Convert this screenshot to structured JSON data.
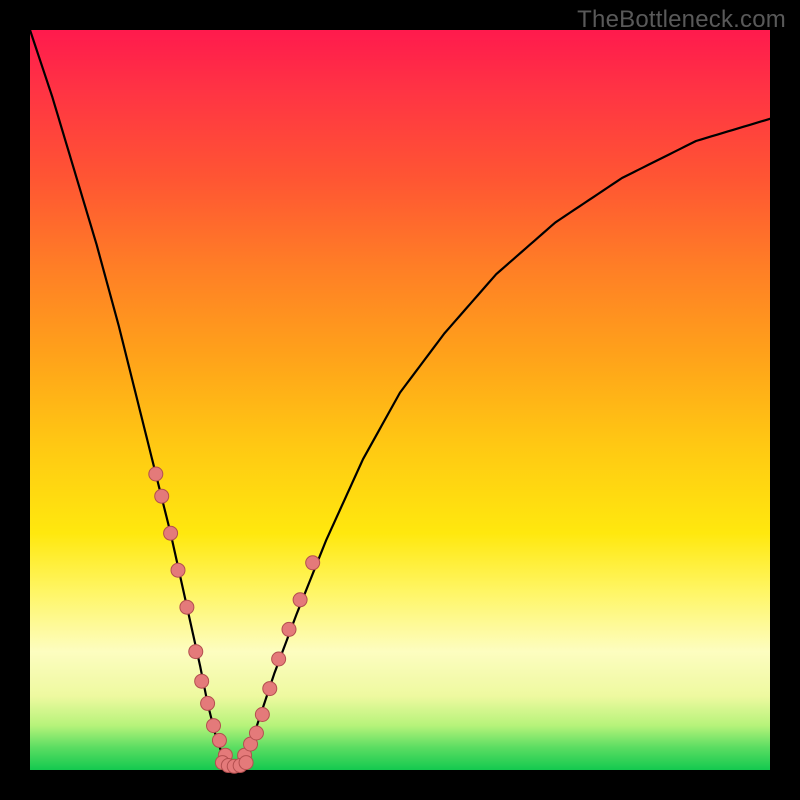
{
  "watermark": "TheBottleneck.com",
  "colors": {
    "background": "#000000",
    "curve_stroke": "#000000",
    "dot_fill": "#e47a7a",
    "dot_stroke": "#b34f4f",
    "gradient_top": "#ff1a4d",
    "gradient_bottom": "#13c94f"
  },
  "chart_data": {
    "type": "line",
    "title": "",
    "xlabel": "",
    "ylabel": "",
    "xlim": [
      0,
      100
    ],
    "ylim": [
      0,
      100
    ],
    "legend": false,
    "grid": false,
    "annotations": [],
    "description": "V-shaped bottleneck curve. Y value represents bottleneck severity (100 = worst/red, 0 = none/green). Minimum (optimal balance point) occurs near x ≈ 27. Left branch descends steeply from top-left; right branch rises with decreasing slope toward top-right.",
    "series": [
      {
        "name": "bottleneck-curve",
        "x": [
          0,
          3,
          6,
          9,
          12,
          15,
          17,
          19,
          21,
          23,
          24,
          25,
          26,
          27,
          28,
          29,
          30,
          31,
          33,
          36,
          40,
          45,
          50,
          56,
          63,
          71,
          80,
          90,
          100
        ],
        "y": [
          100,
          91,
          81,
          71,
          60,
          48,
          40,
          32,
          23,
          14,
          9,
          5,
          2,
          0.5,
          0.5,
          2,
          4,
          7,
          13,
          21,
          31,
          42,
          51,
          59,
          67,
          74,
          80,
          85,
          88
        ]
      }
    ],
    "dots_left_branch": {
      "name": "highlight-dots-left",
      "x": [
        17.0,
        17.8,
        19.0,
        20.0,
        21.2,
        22.4,
        23.2,
        24.0,
        24.8,
        25.6,
        26.4
      ],
      "y": [
        40,
        37,
        32,
        27,
        22,
        16,
        12,
        9,
        6,
        4,
        2
      ]
    },
    "dots_right_branch": {
      "name": "highlight-dots-right",
      "x": [
        29.0,
        29.8,
        30.6,
        31.4,
        32.4,
        33.6,
        35.0,
        36.5,
        38.2
      ],
      "y": [
        2,
        3.5,
        5,
        7.5,
        11,
        15,
        19,
        23,
        28
      ]
    },
    "dots_valley": {
      "name": "highlight-dots-valley",
      "x": [
        26.0,
        26.8,
        27.6,
        28.4,
        29.2
      ],
      "y": [
        1.0,
        0.6,
        0.5,
        0.6,
        1.0
      ]
    }
  }
}
